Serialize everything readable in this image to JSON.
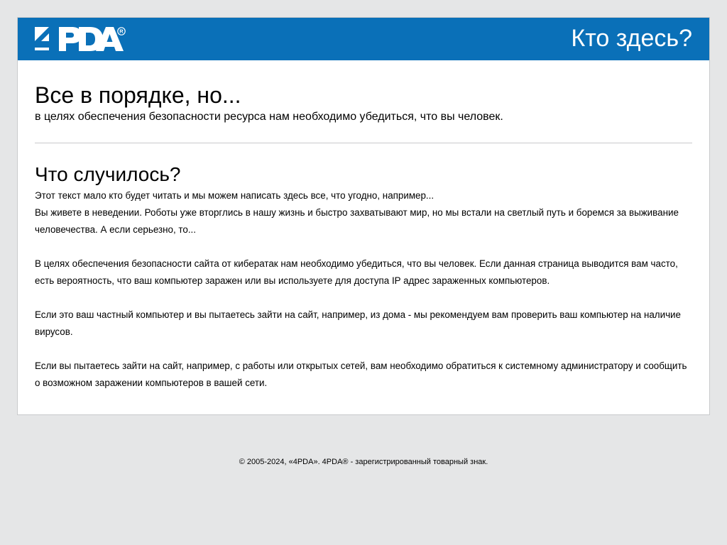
{
  "header": {
    "logo_text": "4PDA",
    "title": "Кто здесь?"
  },
  "main": {
    "headline": "Все в порядке, но...",
    "subline": "в целях обеспечения безопасности ресурса нам необходимо убедиться, что вы человек.",
    "section_title": "Что случилось?",
    "paragraphs": [
      "Этот текст мало кто будет читать и мы можем написать здесь все, что угодно, например...",
      "Вы живете в неведении. Роботы уже вторглись в нашу жизнь и быстро захватывают мир, но мы встали на светлый путь и боремся за выживание человечества. А если серьезно, то...",
      "В целях обеспечения безопасности сайта от кибератак нам необходимо убедиться, что вы человек. Если данная страница выводится вам часто, есть вероятность, что ваш компьютер заражен или вы используете для доступа IP адрес зараженных компьютеров.",
      "Если это ваш частный компьютер и вы пытаетесь зайти на сайт, например, из дома - мы рекомендуем вам проверить ваш компьютер на наличие вирусов.",
      "Если вы пытаетесь зайти на сайт, например, с работы или открытых сетей, вам необходимо обратиться к системному администратору и сообщить о возможном заражении компьютеров в вашей сети."
    ]
  },
  "footer": {
    "text": "© 2005-2024, «4PDA». 4PDA® - зарегистрированный товарный знак."
  },
  "colors": {
    "header_bg": "#0a70b8",
    "page_bg": "#e5e6e7"
  }
}
